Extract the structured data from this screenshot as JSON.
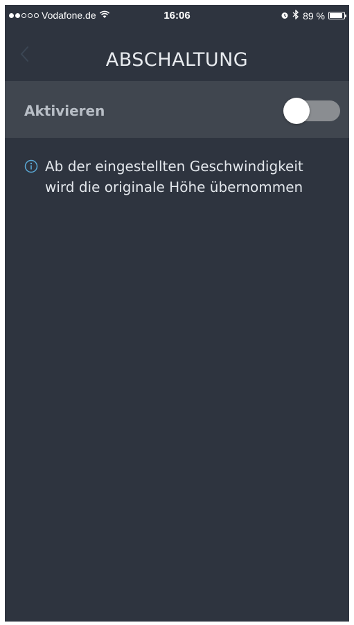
{
  "status_bar": {
    "carrier": "Vodafone.de",
    "time": "16:06",
    "battery_percent": "89 %",
    "battery_level": 0.89,
    "signal_bars_filled": 2,
    "signal_bars_total": 5
  },
  "nav": {
    "title": "ABSCHALTUNG",
    "back_icon": "chevron-left-icon"
  },
  "setting": {
    "label": "Aktivieren",
    "toggle_on": false
  },
  "info": {
    "icon": "info-icon",
    "text": "Ab der eingestellten Geschwindigkeit wird die originale Höhe übernommen"
  },
  "colors": {
    "background": "#2e343f",
    "row_background": "#40464f",
    "accent": "#5aa9d6",
    "toggle_track_off": "#8a8d91"
  }
}
